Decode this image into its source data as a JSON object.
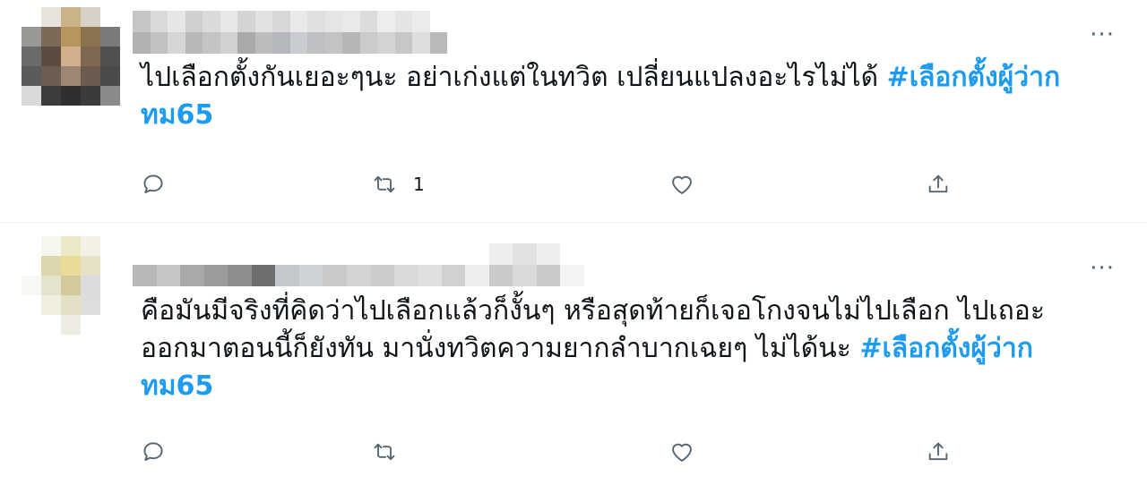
{
  "tweets": [
    {
      "text": "ไปเลือกตั้งกันเยอะๆนะ อย่าเก่งแต่ในทวิต เปลี่ยนแปลงอะไรไม่ได้ ",
      "hashtag": "#เลือกตั้งผู้ว่ากทม65",
      "retweet_count": "1",
      "icons": [
        "reply-icon",
        "retweet-icon",
        "like-icon",
        "share-icon",
        "more-icon"
      ]
    },
    {
      "text": "คือมันมีจริงที่คิดว่าไปเลือกแล้วก็งั้นๆ หรือสุดท้ายก็เจอโกงจนไม่ไปเลือก ไปเถอะ ออกมาตอนนี้ก็ยังทัน มานั่งทวิตความยากลำบากเฉยๆ ไม่ได้นะ  ",
      "hashtag": "#เลือกตั้งผู้ว่ากทม65",
      "retweet_count": "",
      "icons": [
        "reply-icon",
        "retweet-icon",
        "like-icon",
        "share-icon",
        "more-icon"
      ]
    }
  ],
  "more_label": "···",
  "colors": {
    "hashtag": "#1d9bf0",
    "icon": "#536471",
    "divider": "#eff3f4"
  }
}
